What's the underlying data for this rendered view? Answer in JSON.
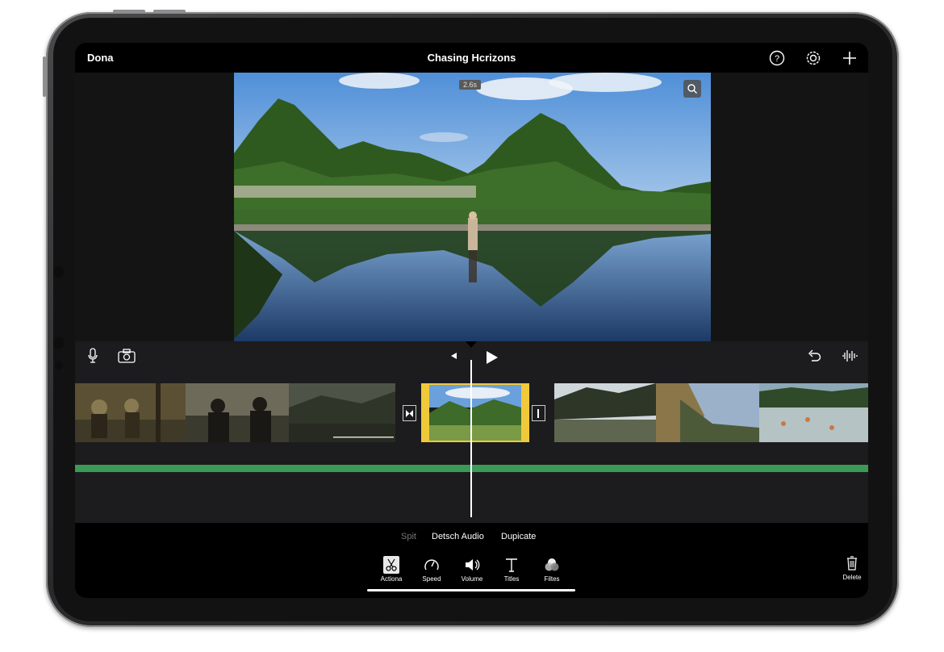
{
  "topbar": {
    "done_label": "Dona",
    "title": "Chasing Hcrizons",
    "icons": [
      "help-icon",
      "settings-gear-icon",
      "add-plus-icon"
    ]
  },
  "viewer": {
    "time_badge": "2.6s",
    "zoom_icon": "zoom-magnifier-icon"
  },
  "timeline_toolbar": {
    "left_icons": [
      "microphone-icon",
      "camera-icon"
    ],
    "center_icons": [
      "marker-left-icon",
      "play-icon"
    ],
    "right_icons": [
      "undo-icon",
      "audio-waveform-icon"
    ]
  },
  "clips": [
    {
      "label": "clip-forest-people"
    },
    {
      "label": "clip-dark-field"
    },
    {
      "label": "clip-mountain-selected",
      "selected": true
    },
    {
      "label": "clip-tree-landscape"
    },
    {
      "label": "clip-rocky-cliff"
    },
    {
      "label": "clip-river-boats"
    }
  ],
  "actions": {
    "split": "Spit",
    "detach_audio": "Detsch Audio",
    "duplicate": "Dupicate"
  },
  "tabs": [
    {
      "label": "Actiona",
      "icon": "scissors-icon",
      "active": true
    },
    {
      "label": "Speed",
      "icon": "speedometer-icon"
    },
    {
      "label": "Volume",
      "icon": "speaker-icon"
    },
    {
      "label": "Titles",
      "icon": "text-t-icon"
    },
    {
      "label": "Filtes",
      "icon": "filters-circles-icon"
    }
  ],
  "delete_label": "Delete",
  "colors": {
    "accent_selection": "#f0c93a",
    "audio_track": "#3a9b57"
  }
}
